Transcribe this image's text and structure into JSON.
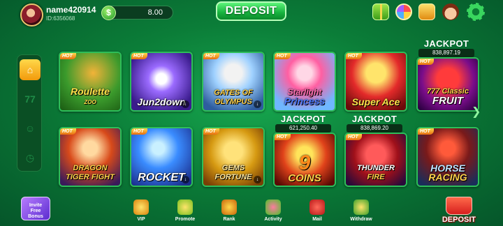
{
  "header": {
    "username": "name420914",
    "user_id": "ID:6356068",
    "balance_symbol": "$",
    "balance": "8.00",
    "deposit_label": "DEPOSIT",
    "icons": [
      "gift-icon",
      "lucky-wheel-icon",
      "puzzle-icon",
      "support-avatar-icon",
      "settings-gear-icon"
    ]
  },
  "sidebar": {
    "items": [
      {
        "name": "home",
        "glyph": "⌂"
      },
      {
        "name": "slots",
        "glyph": "77"
      },
      {
        "name": "live",
        "glyph": "☺"
      },
      {
        "name": "recent",
        "glyph": "◷"
      }
    ]
  },
  "games_row1": [
    {
      "badge": "HOT",
      "title": "Roulette",
      "subtitle": "ZOO"
    },
    {
      "badge": "HOT",
      "title": "Jun2down",
      "subtitle": ""
    },
    {
      "badge": "HOT",
      "title": "GATES OF",
      "subtitle": "OLYMPUS"
    },
    {
      "badge": "HOT",
      "title": "Starlight",
      "subtitle": "Princess"
    },
    {
      "badge": "HOT",
      "title": "Super Ace",
      "subtitle": ""
    },
    {
      "badge": "HOT",
      "title": "777 Classic",
      "subtitle": "FRUIT",
      "jackpot_label": "JACKPOT",
      "jackpot_value": "838,897.19"
    }
  ],
  "games_row2": [
    {
      "badge": "HOT",
      "title": "DRAGON",
      "subtitle": "TIGER FIGHT"
    },
    {
      "badge": "HOT",
      "title": "ROCKET",
      "subtitle": ""
    },
    {
      "badge": "HOT",
      "title": "GEMS",
      "subtitle": "FORTUNE"
    },
    {
      "badge": "HOT",
      "title": "9",
      "subtitle": "COINS",
      "jackpot_label": "JACKPOT",
      "jackpot_value": "621,250.40"
    },
    {
      "badge": "HOT",
      "title": "THUNDER",
      "subtitle": "FIRE",
      "jackpot_label": "JACKPOT",
      "jackpot_value": "838,869.20"
    },
    {
      "badge": "HOT",
      "title": "HORSE",
      "subtitle": "RACING"
    }
  ],
  "bonus": {
    "line1": "Invite",
    "line2": "Free",
    "line3": "Bonus"
  },
  "bottom_nav": [
    {
      "label": "VIP"
    },
    {
      "label": "Promote"
    },
    {
      "label": "Rank"
    },
    {
      "label": "Activity"
    },
    {
      "label": "Mail"
    },
    {
      "label": "Withdraw"
    }
  ],
  "bottom_deposit_label": "DEPOSIT"
}
